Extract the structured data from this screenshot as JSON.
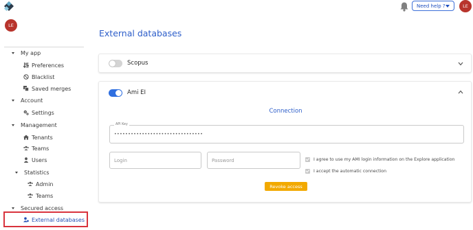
{
  "topbar": {
    "logo_icon": "app-logo-icon",
    "bell_icon": "bell-icon",
    "help_label": "Need help ?",
    "user_initials": "LE",
    "avatar_color": "#b8342c"
  },
  "sidebar": {
    "user_initials": "LE",
    "items": [
      {
        "label": "My app",
        "level": 0,
        "icon": "caret-down-icon"
      },
      {
        "label": "Preferences",
        "level": 1,
        "icon": "sliders-icon"
      },
      {
        "label": "Blacklist",
        "level": 1,
        "icon": "ban-icon"
      },
      {
        "label": "Saved merges",
        "level": 1,
        "icon": "copy-icon"
      },
      {
        "label": "Account",
        "level": 0,
        "icon": "caret-down-icon"
      },
      {
        "label": "Settings",
        "level": 1,
        "icon": "cogs-icon"
      },
      {
        "label": "Management",
        "level": 0,
        "icon": "caret-down-icon"
      },
      {
        "label": "Tenants",
        "level": 1,
        "icon": "home-icon"
      },
      {
        "label": "Teams",
        "level": 1,
        "icon": "users-icon"
      },
      {
        "label": "Users",
        "level": 1,
        "icon": "user-icon"
      },
      {
        "label": "Statistics",
        "level": 1,
        "icon": "caret-down-icon"
      },
      {
        "label": "Admin",
        "level": 2,
        "icon": "users-icon"
      },
      {
        "label": "Teams",
        "level": 2,
        "icon": "users-icon"
      },
      {
        "label": "Secured access",
        "level": 0,
        "icon": "caret-down-icon"
      },
      {
        "label": "External databases",
        "level": 1,
        "icon": "user-gear-icon",
        "active": true
      }
    ]
  },
  "main": {
    "title": "External databases",
    "scopus": {
      "label": "Scopus",
      "enabled": false
    },
    "ami": {
      "label": "Ami EI",
      "enabled": true,
      "connection_title": "Connection",
      "api_key_label": "API Key",
      "api_key_value": "••••••••••••••••••••••••••••••••",
      "login_placeholder": "Login",
      "password_placeholder": "Password",
      "agree_label": "I agree to use my AMI login information on the Explore application",
      "accept_label": "I accept the automatic connection",
      "revoke_label": "Revoke access"
    },
    "accent_color": "#2c5dc9",
    "button_color": "#f2a900"
  }
}
